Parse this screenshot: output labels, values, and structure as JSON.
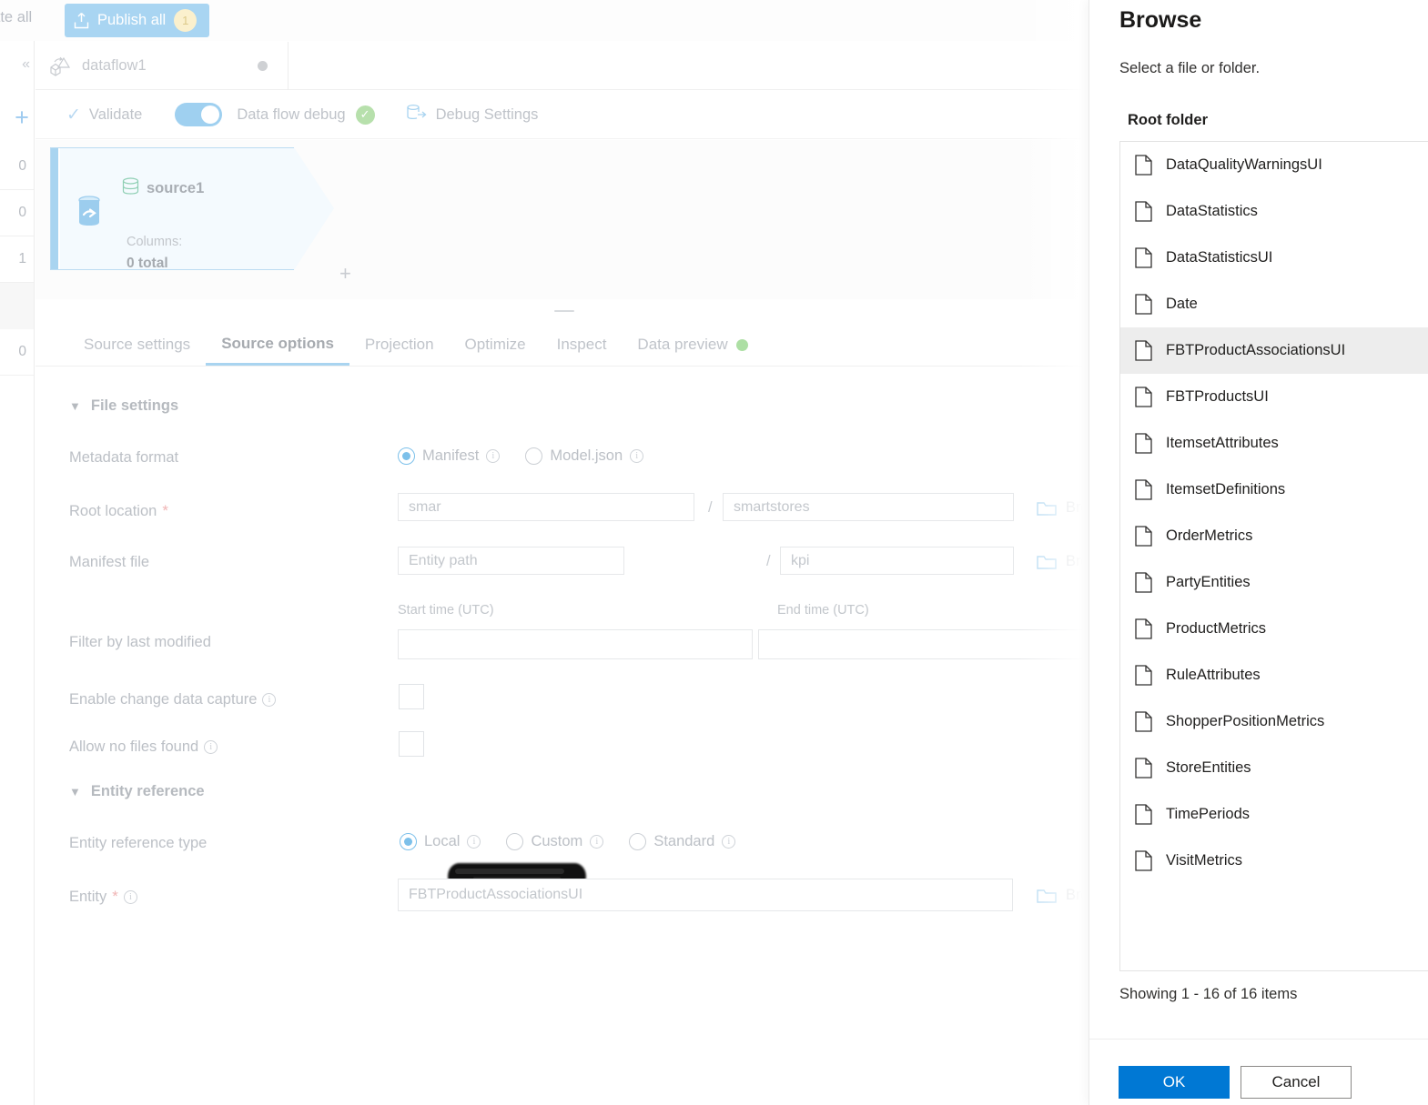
{
  "command_bar": {
    "validate_all_partial": "date all",
    "publish_all_label": "Publish all",
    "publish_all_count": "1",
    "publish_icon": "upload-icon"
  },
  "left_rail": {
    "collapse_icon": "chevron-double-left-icon",
    "add_icon": "plus-icon",
    "counts": [
      "0",
      "0",
      "1",
      "0"
    ]
  },
  "dataflow_tab": {
    "icon": "dataflow-icon",
    "name": "dataflow1",
    "status_icon": "status-dot-icon"
  },
  "debug_toolbar": {
    "validate_label": "Validate",
    "validate_icon": "checkmark-icon",
    "debug_toggle_label": "Data flow debug",
    "debug_toggle_state": "on",
    "debug_status_icon": "success-check-icon",
    "debug_settings_label": "Debug Settings",
    "debug_settings_icon": "debug-settings-icon"
  },
  "canvas": {
    "node": {
      "icon": "source-database-icon",
      "stream_icon": "source-stream-icon",
      "name": "source1",
      "columns_label": "Columns:",
      "columns_value": "0 total",
      "add_icon": "plus-icon"
    }
  },
  "settings_tabs": [
    {
      "label": "Source settings",
      "active": false
    },
    {
      "label": "Source options",
      "active": true
    },
    {
      "label": "Projection",
      "active": false
    },
    {
      "label": "Optimize",
      "active": false
    },
    {
      "label": "Inspect",
      "active": false
    },
    {
      "label": "Data preview",
      "active": false,
      "status_dot": "#92d17f"
    }
  ],
  "form": {
    "file_settings_group": "File settings",
    "entity_reference_group": "Entity reference",
    "metadata_format": {
      "label": "Metadata format",
      "options": [
        {
          "label": "Manifest",
          "selected": true,
          "info": true
        },
        {
          "label": "Model.json",
          "selected": false,
          "info": true
        }
      ]
    },
    "root_location": {
      "label": "Root location",
      "required": true,
      "container_value": "smar",
      "container_redacted": true,
      "separator": "/",
      "folder_value": "smartstores",
      "browse_label": "Browse",
      "browse_icon": "folder-icon"
    },
    "manifest_file": {
      "label": "Manifest file",
      "entity_path_placeholder": "Entity path",
      "separator": "/",
      "manifest_value": "kpi",
      "browse_label": "Browse",
      "browse_icon": "folder-icon"
    },
    "filter_last_modified": {
      "label": "Filter by last modified",
      "start_label": "Start time (UTC)",
      "end_label": "End time (UTC)",
      "start_value": "",
      "end_value": "",
      "info": true
    },
    "enable_cdc": {
      "label": "Enable change data capture",
      "checked": false,
      "info": true
    },
    "allow_no_files": {
      "label": "Allow no files found",
      "checked": false,
      "info": true
    },
    "entity_reference_type": {
      "label": "Entity reference type",
      "options": [
        {
          "label": "Local",
          "selected": true,
          "info": true
        },
        {
          "label": "Custom",
          "selected": false,
          "info": true
        },
        {
          "label": "Standard",
          "selected": false,
          "info": true
        }
      ]
    },
    "entity": {
      "label": "Entity",
      "required": true,
      "info": true,
      "value": "FBTProductAssociationsUI",
      "browse_label": "Browse",
      "browse_icon": "folder-icon"
    }
  },
  "browse_panel": {
    "title": "Browse",
    "subtitle": "Select a file or folder.",
    "group_label": "Root folder",
    "items": [
      {
        "name": "DataQualityWarningsUI",
        "selected": false
      },
      {
        "name": "DataStatistics",
        "selected": false
      },
      {
        "name": "DataStatisticsUI",
        "selected": false
      },
      {
        "name": "Date",
        "selected": false
      },
      {
        "name": "FBTProductAssociationsUI",
        "selected": true
      },
      {
        "name": "FBTProductsUI",
        "selected": false
      },
      {
        "name": "ItemsetAttributes",
        "selected": false
      },
      {
        "name": "ItemsetDefinitions",
        "selected": false
      },
      {
        "name": "OrderMetrics",
        "selected": false
      },
      {
        "name": "PartyEntities",
        "selected": false
      },
      {
        "name": "ProductMetrics",
        "selected": false
      },
      {
        "name": "RuleAttributes",
        "selected": false
      },
      {
        "name": "ShopperPositionMetrics",
        "selected": false
      },
      {
        "name": "StoreEntities",
        "selected": false
      },
      {
        "name": "TimePeriods",
        "selected": false
      },
      {
        "name": "VisitMetrics",
        "selected": false
      }
    ],
    "item_icon": "file-icon",
    "showing_text": "Showing 1 - 16 of 16 items",
    "ok_label": "OK",
    "cancel_label": "Cancel"
  },
  "colors": {
    "primary_button": "#0078d4",
    "accent_light_blue": "#a9d5f2",
    "badge_bg": "#fbf0cd",
    "success_green": "#b7e0ac",
    "preview_dot": "#addfa4",
    "selected_row": "#ededed"
  }
}
